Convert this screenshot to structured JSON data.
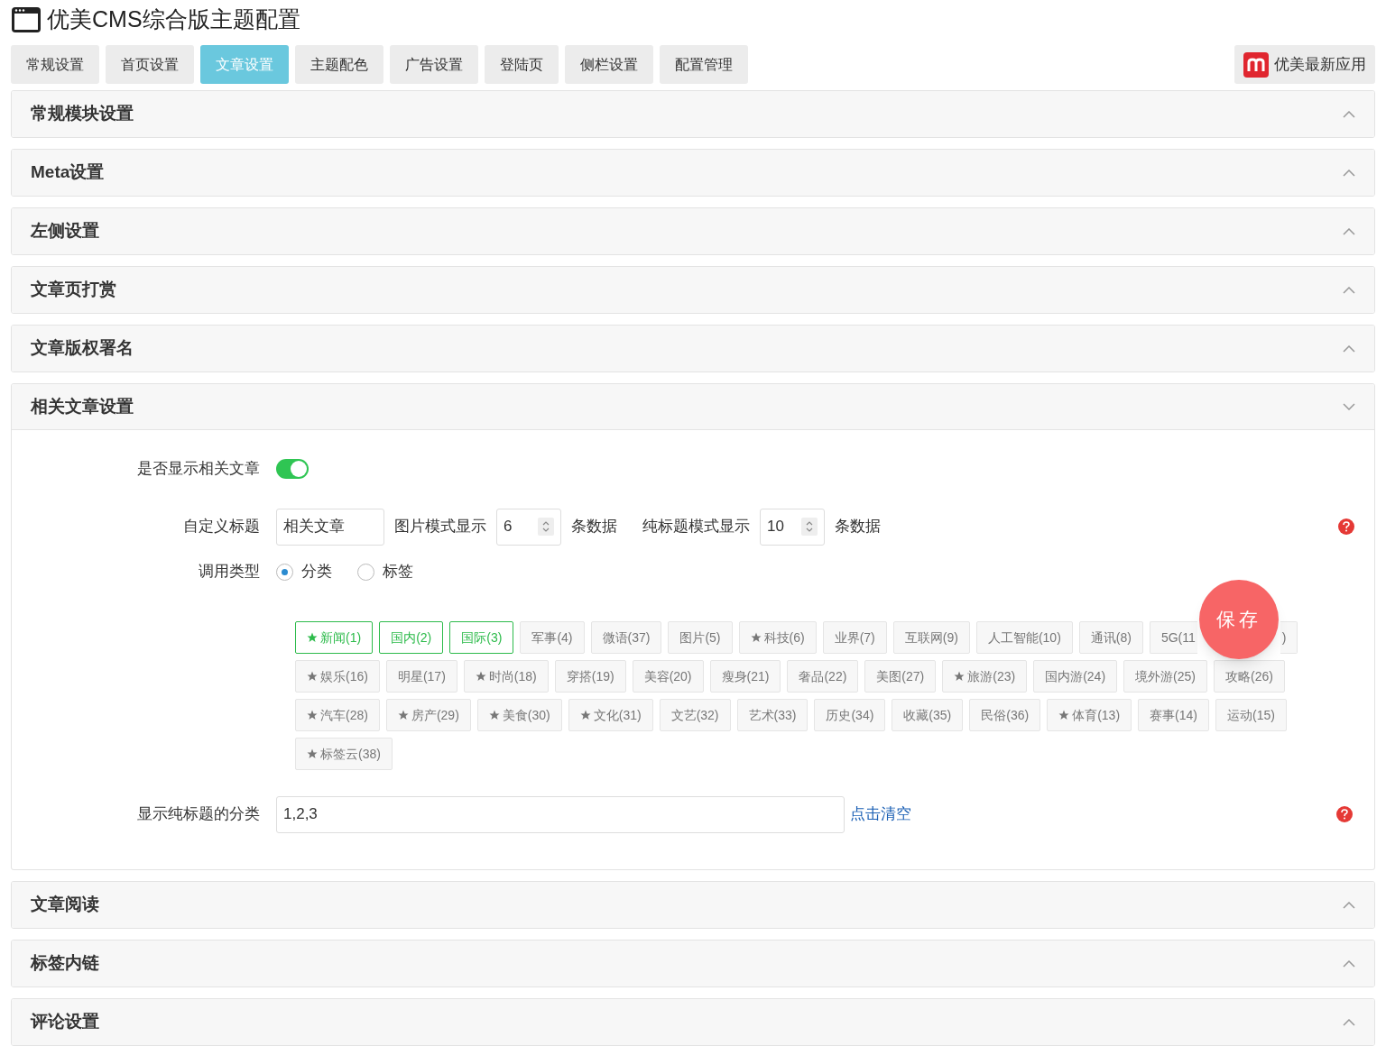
{
  "title": "优美CMS综合版主题配置",
  "tabs": [
    {
      "label": "常规设置",
      "selected": false
    },
    {
      "label": "首页设置",
      "selected": false
    },
    {
      "label": "文章设置",
      "selected": true
    },
    {
      "label": "主题配色",
      "selected": false
    },
    {
      "label": "广告设置",
      "selected": false
    },
    {
      "label": "登陆页",
      "selected": false
    },
    {
      "label": "侧栏设置",
      "selected": false
    },
    {
      "label": "配置管理",
      "selected": false
    }
  ],
  "app_button": "优美最新应用",
  "sections_before": [
    {
      "title": "常规模块设置",
      "expanded": false
    },
    {
      "title": "Meta设置",
      "expanded": false
    },
    {
      "title": "左侧设置",
      "expanded": false
    },
    {
      "title": "文章页打赏",
      "expanded": false
    },
    {
      "title": "文章版权署名",
      "expanded": false
    }
  ],
  "open_section": {
    "title": "相关文章设置",
    "expanded": true,
    "show_label": "是否显示相关文章",
    "show_on": true,
    "title_label": "自定义标题",
    "title_value": "相关文章",
    "image_label": "图片模式显示",
    "image_value": "6",
    "image_unit": "条数据",
    "plain_label": "纯标题模式显示",
    "plain_value": "10",
    "plain_unit": "条数据",
    "type_label": "调用类型",
    "type_options": [
      {
        "label": "分类",
        "selected": true
      },
      {
        "label": "标签",
        "selected": false
      }
    ],
    "tags": [
      {
        "label": "新闻(1)",
        "starred": true,
        "selected": true
      },
      {
        "label": "国内(2)",
        "starred": false,
        "selected": true
      },
      {
        "label": "国际(3)",
        "starred": false,
        "selected": true
      },
      {
        "label": "军事(4)",
        "starred": false,
        "selected": false
      },
      {
        "label": "微语(37)",
        "starred": false,
        "selected": false
      },
      {
        "label": "图片(5)",
        "starred": false,
        "selected": false
      },
      {
        "label": "科技(6)",
        "starred": true,
        "selected": false
      },
      {
        "label": "业界(7)",
        "starred": false,
        "selected": false
      },
      {
        "label": "互联网(9)",
        "starred": false,
        "selected": false
      },
      {
        "label": "人工智能(10)",
        "starred": false,
        "selected": false
      },
      {
        "label": "通讯(8)",
        "starred": false,
        "selected": false
      },
      {
        "label": "5G(11",
        "starred": false,
        "selected": false,
        "kind": "left"
      },
      {
        "label": ")",
        "starred": false,
        "selected": false,
        "kind": "right"
      },
      {
        "label": "娱乐(16)",
        "starred": true,
        "selected": false
      },
      {
        "label": "明星(17)",
        "starred": false,
        "selected": false
      },
      {
        "label": "时尚(18)",
        "starred": true,
        "selected": false
      },
      {
        "label": "穿搭(19)",
        "starred": false,
        "selected": false
      },
      {
        "label": "美容(20)",
        "starred": false,
        "selected": false
      },
      {
        "label": "瘦身(21)",
        "starred": false,
        "selected": false
      },
      {
        "label": "奢品(22)",
        "starred": false,
        "selected": false
      },
      {
        "label": "美图(27)",
        "starred": false,
        "selected": false
      },
      {
        "label": "旅游(23)",
        "starred": true,
        "selected": false
      },
      {
        "label": "国内游(24)",
        "starred": false,
        "selected": false
      },
      {
        "label": "境外游(25)",
        "starred": false,
        "selected": false
      },
      {
        "label": "攻略(26)",
        "starred": false,
        "selected": false
      },
      {
        "label": "汽车(28)",
        "starred": true,
        "selected": false
      },
      {
        "label": "房产(29)",
        "starred": true,
        "selected": false
      },
      {
        "label": "美食(30)",
        "starred": true,
        "selected": false
      },
      {
        "label": "文化(31)",
        "starred": true,
        "selected": false
      },
      {
        "label": "文艺(32)",
        "starred": false,
        "selected": false
      },
      {
        "label": "艺术(33)",
        "starred": false,
        "selected": false
      },
      {
        "label": "历史(34)",
        "starred": false,
        "selected": false
      },
      {
        "label": "收藏(35)",
        "starred": false,
        "selected": false
      },
      {
        "label": "民俗(36)",
        "starred": false,
        "selected": false
      },
      {
        "label": "体育(13)",
        "starred": true,
        "selected": false
      },
      {
        "label": "赛事(14)",
        "starred": false,
        "selected": false
      },
      {
        "label": "运动(15)",
        "starred": false,
        "selected": false
      },
      {
        "label": "标签云(38)",
        "starred": true,
        "selected": false
      }
    ],
    "plain_cat_label": "显示纯标题的分类",
    "plain_cat_value": "1,2,3",
    "clear_link": "点击清空"
  },
  "sections_after": [
    {
      "title": "文章阅读",
      "expanded": false
    },
    {
      "title": "标签内链",
      "expanded": false
    },
    {
      "title": "评论设置",
      "expanded": false
    }
  ],
  "save_button": "保存"
}
